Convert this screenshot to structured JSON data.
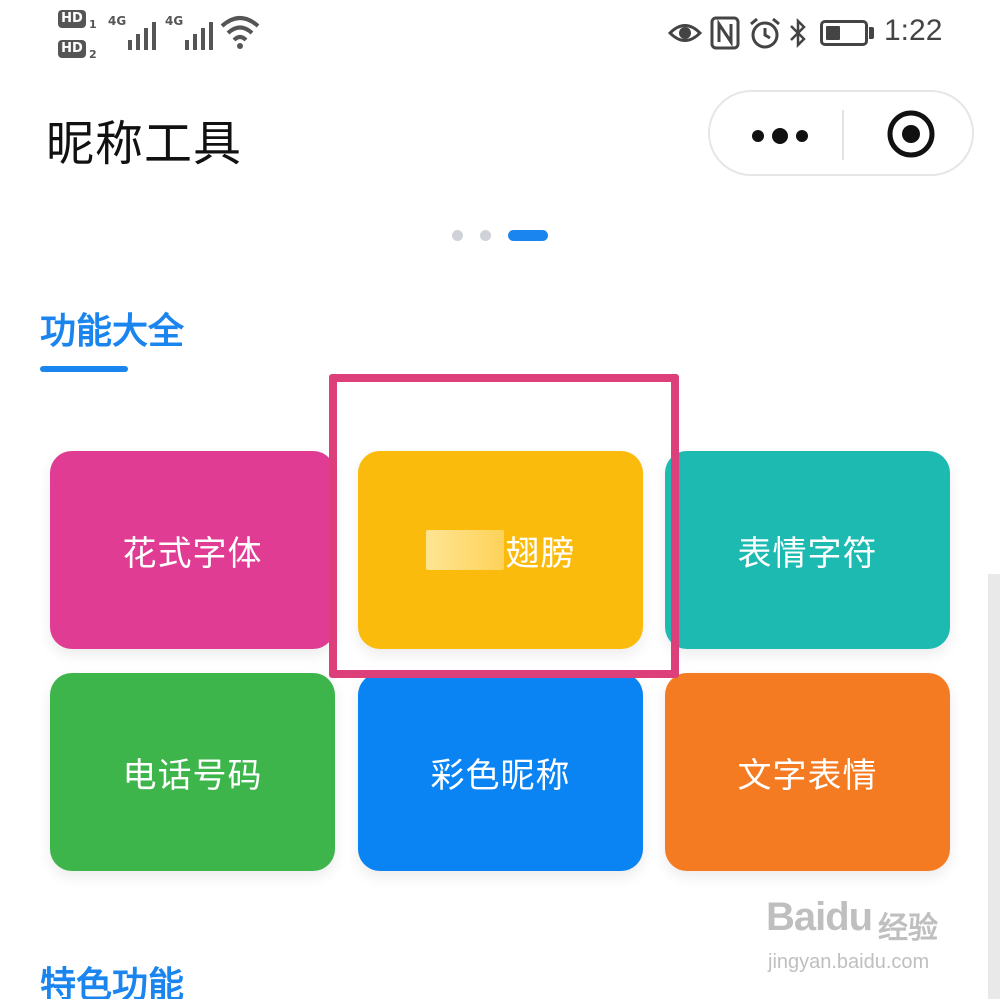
{
  "status_bar": {
    "sim1_badge": "HD",
    "sim1_index": "1",
    "sim2_badge": "HD",
    "sim2_index": "2",
    "signal1_label": "4G",
    "signal2_label": "4G",
    "time": "1:22",
    "battery_level_percent": 40
  },
  "header": {
    "title": "昵称工具"
  },
  "carousel": {
    "page_count": 3,
    "active_index": 2
  },
  "sections": [
    {
      "title": "功能大全",
      "tiles": [
        {
          "label": "花式字体",
          "color": "#e03c93"
        },
        {
          "label": "翅膀",
          "color": "#fbbb0c",
          "redacted_prefix": true,
          "highlighted": true
        },
        {
          "label": "表情字符",
          "color": "#1dbab1"
        },
        {
          "label": "电话号码",
          "color": "#3db54b"
        },
        {
          "label": "彩色昵称",
          "color": "#0b84f3"
        },
        {
          "label": "文字表情",
          "color": "#f47b21"
        }
      ]
    },
    {
      "title": "特色功能"
    }
  ],
  "accent_color": "#1a85ef",
  "highlight_color": "#dc3f7a",
  "watermark": {
    "brand": "Baidu",
    "product": "经验",
    "url": "jingyan.baidu.com"
  },
  "icons": [
    "eye-icon",
    "nfc-icon",
    "alarm-icon",
    "bluetooth-icon",
    "battery-icon",
    "wifi-icon",
    "signal-icon",
    "more-icon",
    "close-target-icon"
  ]
}
